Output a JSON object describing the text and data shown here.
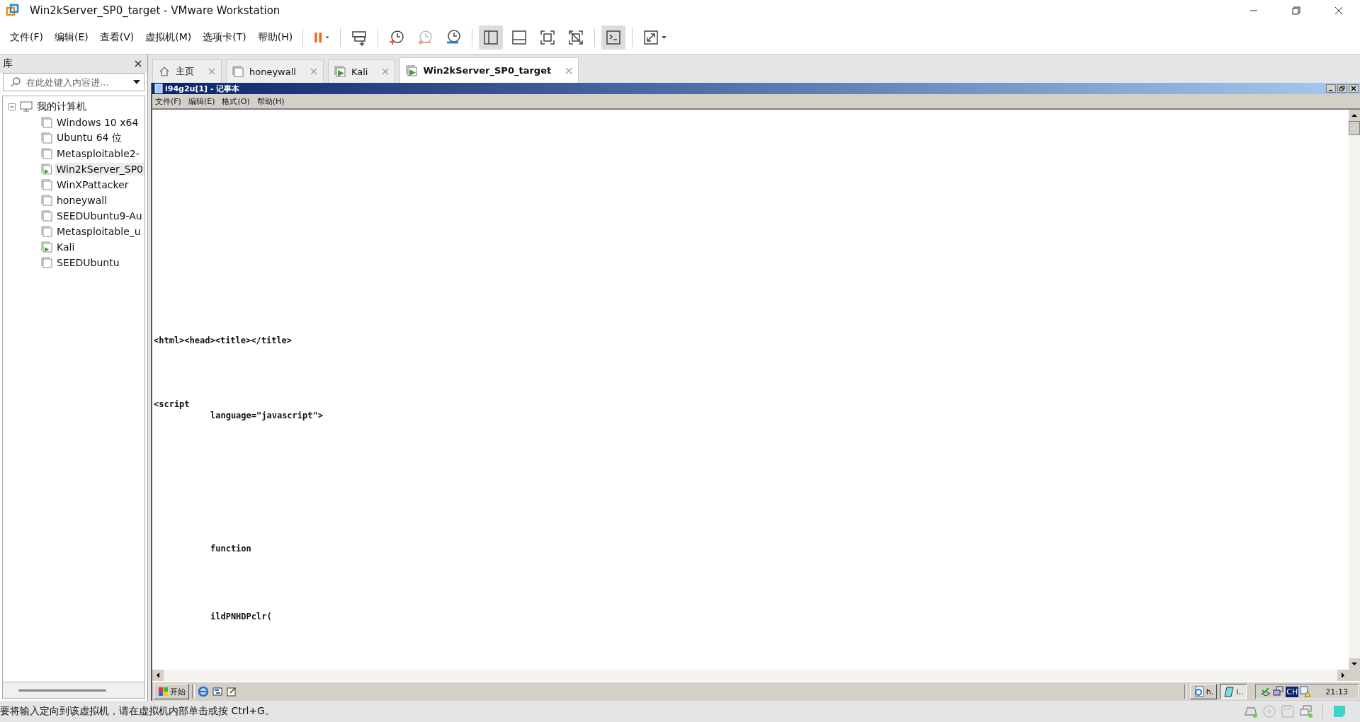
{
  "window": {
    "title": "Win2kServer_SP0_target - VMware Workstation"
  },
  "menu": [
    "文件(F)",
    "编辑(E)",
    "查看(V)",
    "虚拟机(M)",
    "选项卡(T)",
    "帮助(H)"
  ],
  "toolbar": [
    {
      "kind": "pause",
      "pressed": false
    },
    {
      "kind": "send-keys",
      "pressed": false
    },
    {
      "kind": "snapshot",
      "pressed": false
    },
    {
      "kind": "revert",
      "pressed": false
    },
    {
      "kind": "manager",
      "pressed": false
    },
    {
      "kind": "library",
      "pressed": true
    },
    {
      "kind": "thumbnails",
      "pressed": false
    },
    {
      "kind": "fullscreen",
      "pressed": false
    },
    {
      "kind": "unity",
      "pressed": false
    },
    {
      "kind": "console",
      "pressed": true
    },
    {
      "kind": "stretch",
      "pressed": false
    }
  ],
  "library": {
    "title": "库",
    "search": {
      "placeholder": "在此处键入内容进..."
    },
    "tree": {
      "label": "我的计算机",
      "expanded": true,
      "children": [
        {
          "label": "Windows 10 x64",
          "running": false,
          "selected": false
        },
        {
          "label": "Ubuntu 64 位",
          "running": false,
          "selected": false
        },
        {
          "label": "Metasploitable2-",
          "running": false,
          "selected": false
        },
        {
          "label": "Win2kServer_SP0",
          "running": true,
          "selected": true
        },
        {
          "label": "WinXPattacker",
          "running": false,
          "selected": false
        },
        {
          "label": "honeywall",
          "running": false,
          "selected": false
        },
        {
          "label": "SEEDUbuntu9-Au",
          "running": false,
          "selected": false
        },
        {
          "label": "Metasploitable_u",
          "running": false,
          "selected": false
        },
        {
          "label": "Kali",
          "running": true,
          "selected": false
        },
        {
          "label": "SEEDUbuntu",
          "running": false,
          "selected": false
        }
      ]
    }
  },
  "tabs": [
    {
      "label": "主页",
      "kind": "home",
      "selected": false
    },
    {
      "label": "honeywall",
      "kind": "vm",
      "running": false,
      "selected": false
    },
    {
      "label": "Kali",
      "kind": "vm",
      "running": true,
      "selected": false
    },
    {
      "label": "Win2kServer_SP0_target",
      "kind": "vm",
      "running": true,
      "selected": true
    }
  ],
  "notepad": {
    "title": "i94g2u[1] - 记事本",
    "menu": [
      "文件(F)",
      "编辑(E)",
      "格式(O)",
      "帮助(H)"
    ],
    "lines": [
      "<html><head><title></title>",
      "<script",
      "\tlanguage=\"javascript\">",
      "\tfunction",
      "\tildPNHDPclr("
    ]
  },
  "taskbar": {
    "start": "开始",
    "tasks": [
      {
        "label": "h.",
        "kind": "browser",
        "selected": false
      },
      {
        "label": "i..",
        "kind": "notepad",
        "selected": true
      }
    ],
    "tray_language": "CH",
    "clock": "21:13"
  },
  "status_bar": {
    "text": "要将输入定向到该虚拟机，请在虚拟机内部单击或按 Ctrl+G。"
  }
}
